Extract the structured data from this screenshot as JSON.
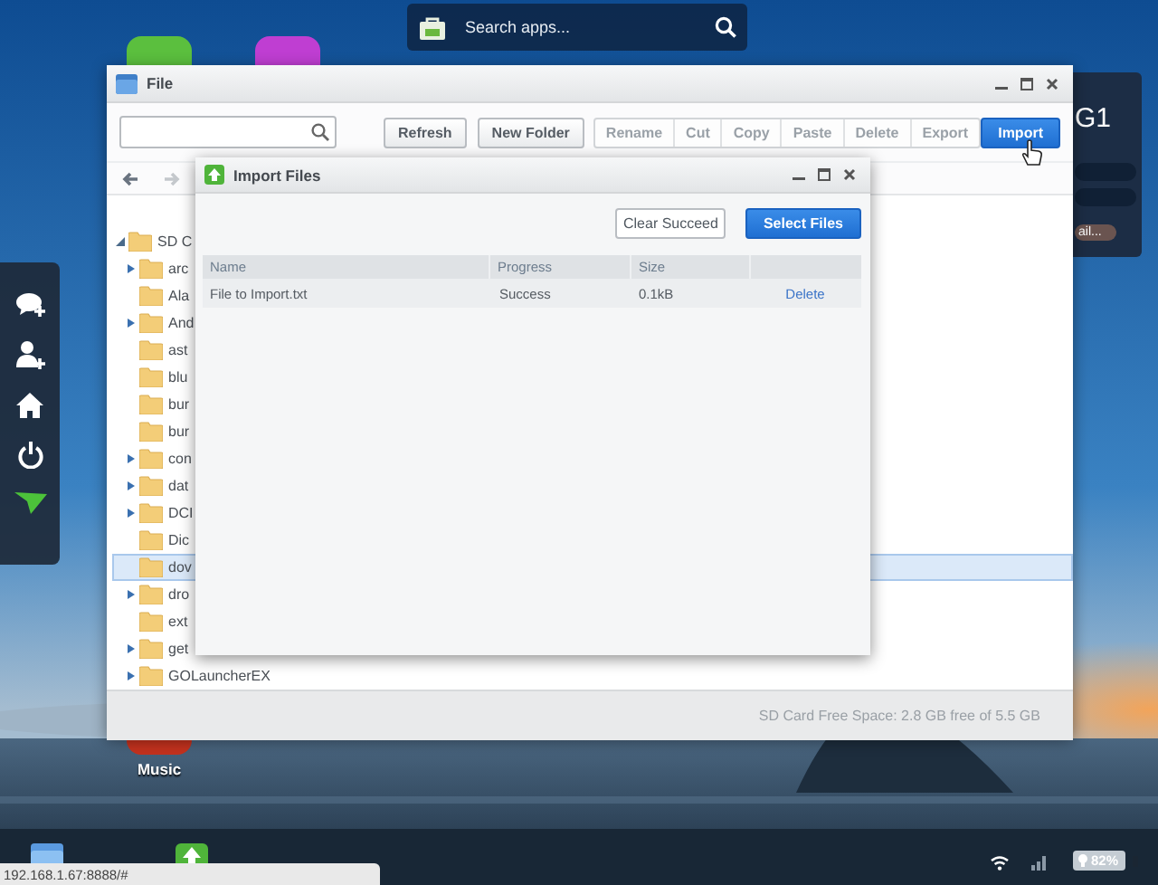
{
  "search_bar": {
    "placeholder": "Search apps..."
  },
  "side_panel": {
    "title": "G1",
    "button": "ail..."
  },
  "file_window": {
    "title": "File",
    "toolbar": [
      {
        "label": "Refresh",
        "kind": "normal",
        "disabled": false
      },
      {
        "label": "New Folder",
        "kind": "normal",
        "disabled": false
      },
      {
        "label": "Rename",
        "kind": "grouped",
        "disabled": true
      },
      {
        "label": "Cut",
        "kind": "grouped",
        "disabled": true
      },
      {
        "label": "Copy",
        "kind": "grouped",
        "disabled": true
      },
      {
        "label": "Paste",
        "kind": "grouped",
        "disabled": true
      },
      {
        "label": "Delete",
        "kind": "grouped",
        "disabled": true
      },
      {
        "label": "Export",
        "kind": "grouped",
        "disabled": true
      },
      {
        "label": "Import",
        "kind": "primary",
        "disabled": false
      }
    ],
    "nav": [
      {
        "kind": "back",
        "disabled": false
      },
      {
        "kind": "forward",
        "disabled": true
      }
    ],
    "tree": [
      {
        "label": "SD C",
        "expanded": true,
        "selected": false,
        "children": [
          {
            "label": "arc",
            "expandable": true,
            "selected": false
          },
          {
            "label": "Ala",
            "expandable": false,
            "selected": false
          },
          {
            "label": "And",
            "expandable": true,
            "selected": false
          },
          {
            "label": "ast",
            "expandable": false,
            "selected": false
          },
          {
            "label": "blu",
            "expandable": false,
            "selected": false
          },
          {
            "label": "bur",
            "expandable": false,
            "selected": false
          },
          {
            "label": "bur",
            "expandable": false,
            "selected": false
          },
          {
            "label": "con",
            "expandable": true,
            "selected": false
          },
          {
            "label": "dat",
            "expandable": true,
            "selected": false
          },
          {
            "label": "DCI",
            "expandable": true,
            "selected": false
          },
          {
            "label": "Dic",
            "expandable": false,
            "selected": false
          },
          {
            "label": "dov",
            "expandable": false,
            "selected": true
          },
          {
            "label": "dro",
            "expandable": true,
            "selected": false
          },
          {
            "label": "ext",
            "expandable": false,
            "selected": false
          },
          {
            "label": "get",
            "expandable": true,
            "selected": false
          },
          {
            "label": "GOLauncherEX",
            "expandable": true,
            "selected": false
          }
        ]
      }
    ],
    "status": "SD Card Free Space: 2.8 GB free of 5.5 GB"
  },
  "import_dialog": {
    "title": "Import Files",
    "buttons": [
      {
        "label": "Clear Succeed",
        "kind": "normal"
      },
      {
        "label": "Select Files",
        "kind": "primary"
      }
    ],
    "columns": [
      "Name",
      "Progress",
      "Size"
    ],
    "rows": [
      {
        "name": "File to Import.txt",
        "progress": "Success",
        "size": "0.1kB",
        "action": "Delete"
      }
    ]
  },
  "desktop_icons": [
    {
      "label": "Music"
    }
  ],
  "url": "192.168.1.67:8888/#",
  "battery": "82%"
}
